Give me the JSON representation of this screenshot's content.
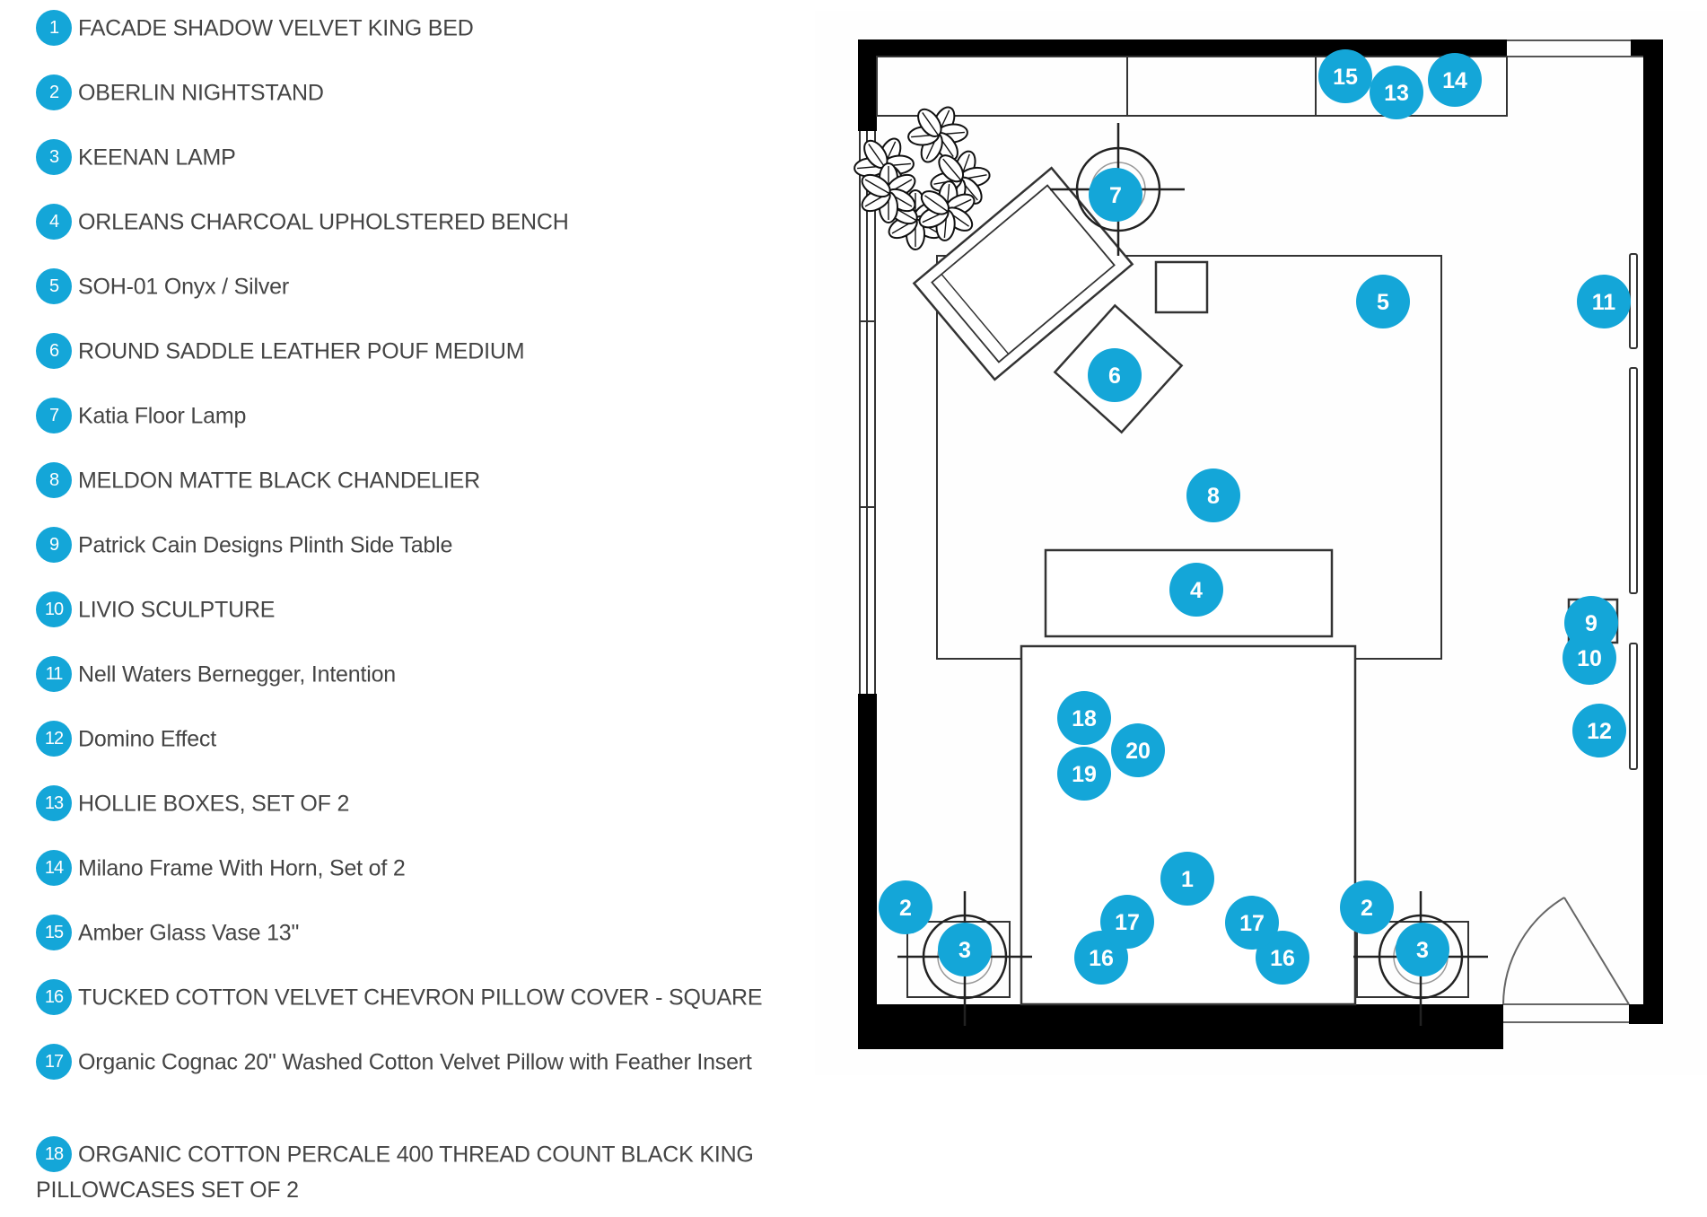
{
  "colors": {
    "badge": "#14a6d8",
    "text": "#444444",
    "wall": "#000000",
    "line": "#222222"
  },
  "legend": {
    "items": [
      {
        "num": "1",
        "label": "FACADE SHADOW VELVET KING BED"
      },
      {
        "num": "2",
        "label": "OBERLIN NIGHTSTAND"
      },
      {
        "num": "3",
        "label": "KEENAN LAMP"
      },
      {
        "num": "4",
        "label": "ORLEANS CHARCOAL UPHOLSTERED BENCH"
      },
      {
        "num": "5",
        "label": "SOH-01 Onyx / Silver"
      },
      {
        "num": "6",
        "label": "ROUND SADDLE LEATHER POUF MEDIUM"
      },
      {
        "num": "7",
        "label": "Katia Floor Lamp"
      },
      {
        "num": "8",
        "label": "MELDON MATTE BLACK CHANDELIER"
      },
      {
        "num": "9",
        "label": "Patrick Cain Designs Plinth Side Table"
      },
      {
        "num": "10",
        "label": "LIVIO SCULPTURE"
      },
      {
        "num": "11",
        "label": "Nell Waters Bernegger, Intention"
      },
      {
        "num": "12",
        "label": "Domino Effect"
      },
      {
        "num": "13",
        "label": "HOLLIE BOXES, SET OF 2"
      },
      {
        "num": "14",
        "label": "Milano Frame With Horn, Set of 2"
      },
      {
        "num": "15",
        "label": "Amber Glass Vase 13\""
      },
      {
        "num": "16",
        "label": "TUCKED COTTON VELVET CHEVRON PILLOW COVER - SQUARE"
      },
      {
        "num": "17",
        "label": "Organic Cognac 20\" Washed Cotton Velvet Pillow with Feather Insert"
      },
      {
        "num": "18",
        "label": "ORGANIC COTTON PERCALE 400 THREAD COUNT BLACK KING PILLOWCASES SET OF 2"
      }
    ]
  },
  "floorplan": {
    "markers": [
      {
        "num": "1",
        "item": "bed"
      },
      {
        "num": "2",
        "item": "nightstand-left"
      },
      {
        "num": "2",
        "item": "nightstand-right"
      },
      {
        "num": "3",
        "item": "lamp-left"
      },
      {
        "num": "3",
        "item": "lamp-right"
      },
      {
        "num": "4",
        "item": "bench"
      },
      {
        "num": "5",
        "item": "rug"
      },
      {
        "num": "6",
        "item": "pouf"
      },
      {
        "num": "7",
        "item": "floor-lamp"
      },
      {
        "num": "8",
        "item": "chandelier"
      },
      {
        "num": "9",
        "item": "side-table"
      },
      {
        "num": "10",
        "item": "sculpture"
      },
      {
        "num": "11",
        "item": "art-upper"
      },
      {
        "num": "12",
        "item": "art-lower"
      },
      {
        "num": "13",
        "item": "boxes"
      },
      {
        "num": "14",
        "item": "frames"
      },
      {
        "num": "15",
        "item": "vase"
      },
      {
        "num": "16",
        "item": "pillow-left"
      },
      {
        "num": "16",
        "item": "pillow-right"
      },
      {
        "num": "17",
        "item": "pillow-left"
      },
      {
        "num": "17",
        "item": "pillow-right"
      },
      {
        "num": "18",
        "item": "pillowcases"
      },
      {
        "num": "19",
        "item": "bedding"
      },
      {
        "num": "20",
        "item": "bedding"
      }
    ]
  }
}
